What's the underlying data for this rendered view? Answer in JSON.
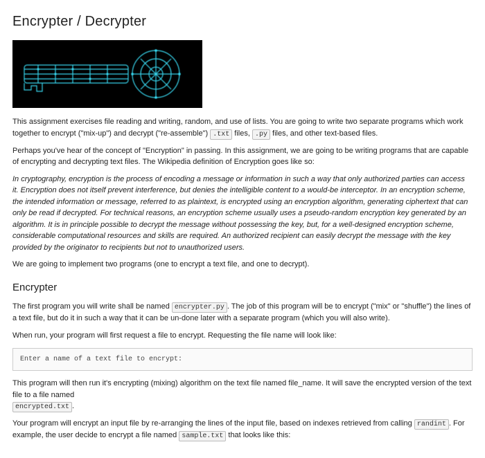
{
  "title": "Encrypter / Decrypter",
  "hero": {
    "alt": "key-circuit-image"
  },
  "intro": {
    "lead": "This assignment exercises file reading and writing, random, and use of lists. You are going to write two separate programs which work together to encrypt (\"mix-up\") and decrypt (\"re-assemble\") ",
    "chip_txt": ".txt",
    "between1": " files, ",
    "chip_py": ".py",
    "tail": " files, and other text-based files."
  },
  "p_concept": "Perhaps you've hear of the concept of \"Encryption\" in passing. In this assignment, we are going to be writing programs that are capable of encrypting and decrypting text files. The Wikipedia definition of Encryption goes like so:",
  "wiki_def": "In cryptography, encryption is the process of encoding a message or information in such a way that only authorized parties can access it. Encryption does not itself prevent interference, but denies the intelligible content to a would-be interceptor. In an encryption scheme, the intended information or message, referred to as plaintext, is encrypted using an encryption algorithm, generating ciphertext that can only be read if decrypted. For technical reasons, an encryption scheme usually uses a pseudo-random encryption key generated by an algorithm. It is in principle possible to decrypt the message without possessing the key, but, for a well-designed encryption scheme, considerable computational resources and skills are required. An authorized recipient can easily decrypt the message with the key provided by the originator to recipients but not to unauthorized users.",
  "p_two_programs": "We are going to implement two programs (one to encrypt a text file, and one to decrypt).",
  "h_encrypter": "Encrypter",
  "enc1": {
    "lead": "The first program you will write shall be named ",
    "chip_script": "encrypter.py",
    "tail": ". The job of this program will be to encrypt (\"mix\" or \"shuffle\") the lines of a text file, but do it in such a way that it can be un-done later with a separate program (which you will also write)."
  },
  "p_when_run": "When run, your program will first request a file to encrypt. Requesting the file name will look like:",
  "prompt_text": "Enter a name of a text file to encrypt:",
  "enc2": {
    "lead": "This program will then run it's encrypting (mixing) algorithm on the text file named file_name. It will save the encrypted version of the text file to a file named ",
    "chip_out": "encrypted.txt",
    "tail": "."
  },
  "enc3": {
    "lead": "Your program will encrypt an input file by re-arranging the lines of the input file, based on indexes retrieved from calling ",
    "chip_fn": "randint",
    "mid": ". For example, the user decide to encrypt a file named ",
    "chip_sample": "sample.txt",
    "tail": " that looks like this:"
  }
}
